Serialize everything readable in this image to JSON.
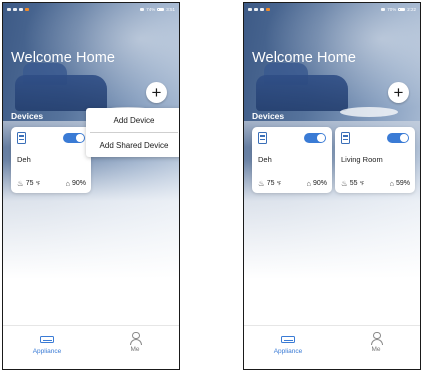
{
  "statusbar": {
    "left": {
      "battery_text": "74%",
      "time": "3:51"
    },
    "right": {
      "battery_text": "70%",
      "time": "2:22"
    }
  },
  "header": {
    "title": "Welcome Home",
    "add_symbol": "+"
  },
  "section": {
    "devices_label": "Devices"
  },
  "menu": {
    "add_device": "Add Device",
    "add_shared_device": "Add Shared Device"
  },
  "devices": [
    {
      "name": "Deh",
      "temperature": "75",
      "temp_unit": "℉",
      "humidity": "90%",
      "power_on": true
    },
    {
      "name": "Living Room",
      "temperature": "55",
      "temp_unit": "℉",
      "humidity": "59%",
      "power_on": true
    }
  ],
  "nav": {
    "appliance": "Appliance",
    "me": "Me"
  },
  "colors": {
    "accent": "#3a7bd5",
    "text": "#222222"
  },
  "icons": {
    "add": "plus-icon",
    "device": "air-conditioner-icon",
    "temperature": "thermometer-icon",
    "humidity": "home-humidity-icon",
    "appliance": "appliance-icon",
    "me": "person-icon"
  }
}
